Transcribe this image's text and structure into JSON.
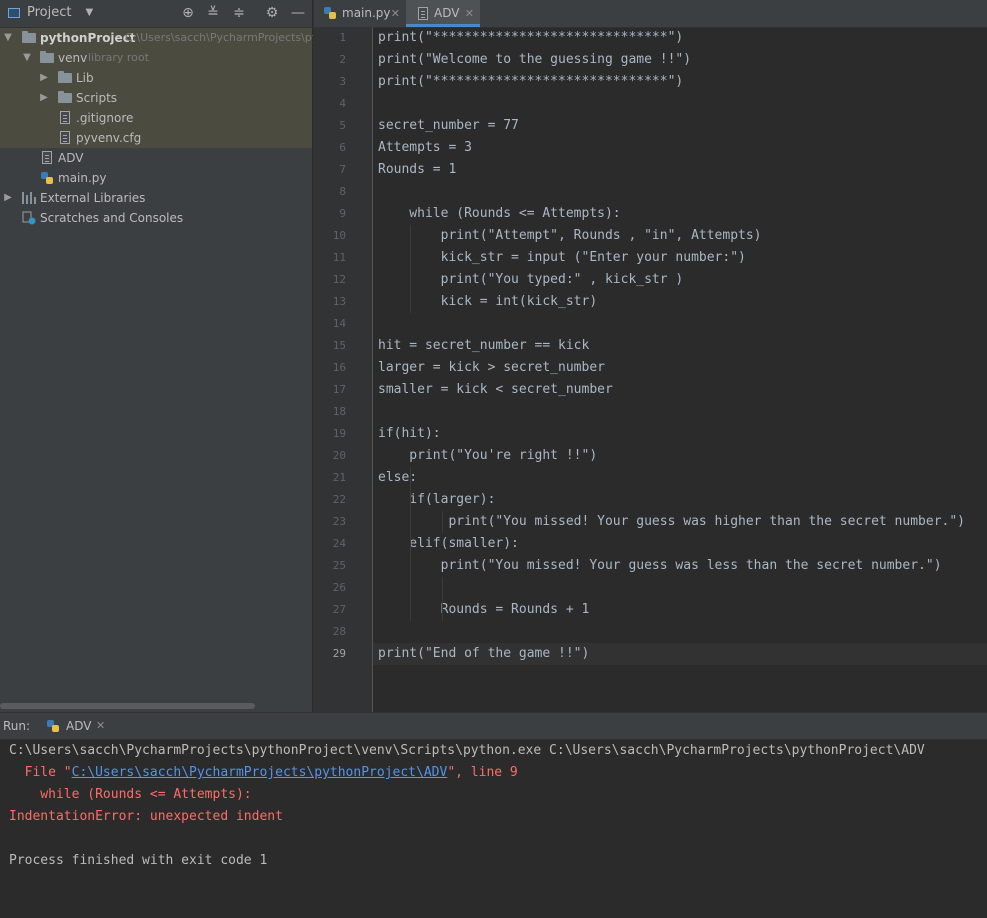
{
  "project_panel": {
    "title": "Project",
    "toolbar_icons": [
      "locate-icon",
      "expand-all-icon",
      "collapse-all-icon",
      "gear-icon",
      "minimize-icon"
    ],
    "tree": [
      {
        "label": "pythonProject",
        "hint": "C:\\Users\\sacch\\PycharmProjects\\py",
        "icon": "folder-icon"
      },
      {
        "label": "venv",
        "hint": "library root",
        "icon": "folder-icon"
      },
      {
        "label": "Lib",
        "icon": "folder-icon"
      },
      {
        "label": "Scripts",
        "icon": "folder-icon"
      },
      {
        "label": ".gitignore",
        "icon": "file-icon"
      },
      {
        "label": "pyvenv.cfg",
        "icon": "file-icon"
      },
      {
        "label": "ADV",
        "icon": "file-icon"
      },
      {
        "label": "main.py",
        "icon": "python-file-icon"
      },
      {
        "label": "External Libraries",
        "icon": "libraries-icon"
      },
      {
        "label": "Scratches and Consoles",
        "icon": "scratches-icon"
      }
    ]
  },
  "editor": {
    "tabs": [
      {
        "label": "main.py",
        "icon": "python-file-icon",
        "active": false
      },
      {
        "label": "ADV",
        "icon": "file-icon",
        "active": true
      }
    ],
    "current_line": 29,
    "lines": [
      "print(\"******************************\")",
      "print(\"Welcome to the guessing game !!\")",
      "print(\"******************************\")",
      "",
      "secret_number = 77",
      "Attempts = 3",
      "Rounds = 1",
      "",
      "    while (Rounds <= Attempts):",
      "        print(\"Attempt\", Rounds , \"in\", Attempts)",
      "        kick_str = input (\"Enter your number:\")",
      "        print(\"You typed:\" , kick_str )",
      "        kick = int(kick_str)",
      "",
      "hit = secret_number == kick",
      "larger = kick > secret_number",
      "smaller = kick < secret_number",
      "",
      "if(hit):",
      "    print(\"You're right !!\")",
      "else:",
      "    if(larger):",
      "         print(\"You missed! Your guess was higher than the secret number.\")",
      "    elif(smaller):",
      "        print(\"You missed! Your guess was less than the secret number.\")",
      "",
      "        Rounds = Rounds + 1",
      "",
      "print(\"End of the game !!\")"
    ]
  },
  "run_panel": {
    "label": "Run:",
    "tab_label": "ADV",
    "output": {
      "command": "C:\\Users\\sacch\\PycharmProjects\\pythonProject\\venv\\Scripts\\python.exe C:\\Users\\sacch\\PycharmProjects\\pythonProject\\ADV",
      "file_prefix": "  File \"",
      "file_link": "C:\\Users\\sacch\\PycharmProjects\\pythonProject\\ADV",
      "file_suffix": "\", line 9",
      "error_code": "    while (Rounds <= Attempts):",
      "error": "IndentationError: unexpected indent",
      "finished": "Process finished with exit code 1"
    }
  },
  "colors": {
    "error": "#ff6b68",
    "link": "#5394ec",
    "accent": "#4a88c7"
  }
}
